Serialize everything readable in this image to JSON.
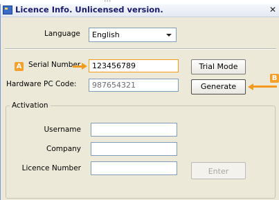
{
  "window": {
    "title": "Licence Info. Unlicensed version.",
    "close_symbol": "✕"
  },
  "language": {
    "label": "Language",
    "selected": "English"
  },
  "serial": {
    "label": "Serial Number",
    "value": "123456789"
  },
  "hardware": {
    "label": "Hardware PC Code:",
    "value": "987654321"
  },
  "buttons": {
    "trial_mode": "Trial Mode",
    "generate": "Generate",
    "enter": "Enter"
  },
  "activation": {
    "legend": "Activation",
    "username_label": "Username",
    "company_label": "Company",
    "licence_number_label": "Licence Number",
    "username_value": "",
    "company_value": "",
    "licence_number_value": ""
  },
  "annotations": {
    "marker_a": "A",
    "marker_b": "B",
    "color": "#f39a1d"
  },
  "colors": {
    "window_bg": "#ece9d8",
    "input_border": "#7f9db9",
    "title_text": "#1a1a6a"
  }
}
